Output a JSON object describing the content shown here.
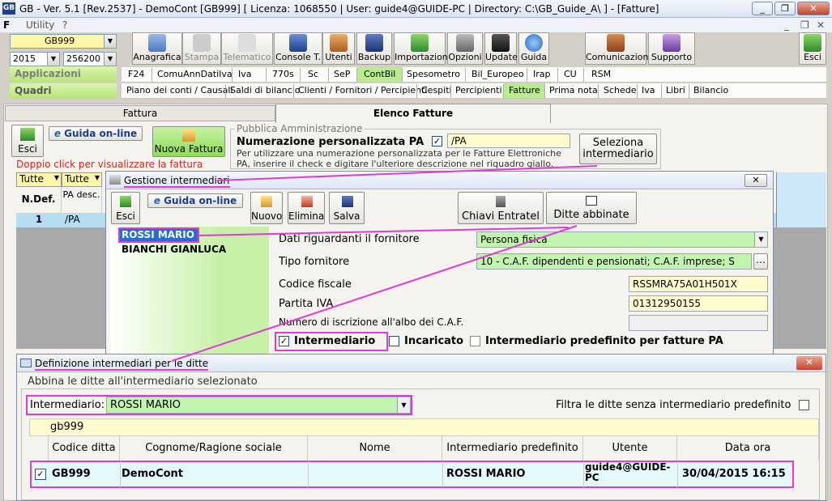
{
  "window": {
    "title": "GB - Ver. 5.1 [Rev.2537] - DemoCont [GB999]    [ Licenza: 1068550 | User: guide4@GUIDE-PC | Directory: C:\\GB_Guide_A\\ ] - [Fatture]",
    "logo": "GB",
    "menu": [
      "Utility",
      "?"
    ]
  },
  "company_combo": "GB999",
  "year_combo": "2015",
  "code_combo": "256200 -",
  "sections": {
    "applicazioni": "Applicazioni",
    "quadri": "Quadri"
  },
  "toolbar": [
    {
      "label": "Anagrafica"
    },
    {
      "label": "Stampa"
    },
    {
      "label": "Telematico"
    },
    {
      "label": "Console T."
    },
    {
      "label": "Utenti"
    },
    {
      "label": "Backup"
    },
    {
      "label": "Importazioni"
    },
    {
      "label": "Opzioni"
    },
    {
      "label": "Update"
    },
    {
      "label": "Guida"
    },
    {
      "label": "Comunicazioni"
    },
    {
      "label": "Supporto"
    },
    {
      "label": "Esci"
    }
  ],
  "app_tabs": [
    "F24",
    "ComuAnnDatiIva",
    "Iva",
    "770s",
    "Sc",
    "SeP",
    "ContBil",
    "Spesometro",
    "Bil_Europeo",
    "Irap",
    "CU",
    "RSM"
  ],
  "quadri_tabs": [
    "Piano dei conti / Causali",
    "Saldi di bilancio",
    "Clienti / Fornitori / Percipienti",
    "Cespiti",
    "Percipienti",
    "Fatture",
    "Prima nota",
    "Schede",
    "Iva",
    "Libri",
    "Bilancio"
  ],
  "doc_tabs": {
    "fattura": "Fattura",
    "elenco": "Elenco Fatture"
  },
  "main": {
    "esci": "Esci",
    "guida_online": "Guida on-line",
    "nuova_fattura": "Nuova Fattura",
    "doppio_click": "Doppio click per visualizzare la fattura",
    "pa_group": "Pubblica Amministrazione",
    "numerazione_label": "Numerazione  personalizzata PA",
    "numerazione_value": "/PA",
    "pa_note": "Per utilizzare una numerazione personalizzata per le Fatture Elettroniche PA, inserire il check e digitare l'ulteriore descrizione nel riquadro giallo.",
    "seleziona_intermediario": "Seleziona intermediario",
    "filter1": "Tutte",
    "filter2": "Tutte",
    "col_ndef": "N.Def.",
    "col_pa": "PA desc.",
    "row_num": "1",
    "row_pa": "/PA"
  },
  "gestione": {
    "title": "Gestione intermediari",
    "esci": "Esci",
    "guida_online": "Guida on-line",
    "nuovo": "Nuovo",
    "elimina": "Elimina",
    "salva": "Salva",
    "chiavi": "Chiavi Entratel",
    "ditte_abbinate": "Ditte abbinate",
    "list": [
      "ROSSI MARIO",
      "BIANCHI GIANLUCA"
    ],
    "dati_fornitore_label": "Dati riguardanti il fornitore",
    "dati_fornitore_value": "Persona fisica",
    "tipo_fornitore_label": "Tipo fornitore",
    "tipo_fornitore_value": "10 - C.A.F. dipendenti e pensionati; C.A.F. imprese; S",
    "cf_label": "Codice fiscale",
    "cf_value": "RSSMRA75A01H501X",
    "piva_label": "Partita IVA",
    "piva_value": "01312950155",
    "albo_label": "Numero di iscrizione all'albo dei C.A.F.",
    "albo_value": "",
    "chk_intermediario": "Intermediario",
    "chk_incaricato": "Incaricato",
    "chk_predefinito": "Intermediario predefinito per fatture PA"
  },
  "definizione": {
    "title": "Definizione intermediari per le ditte",
    "group": "Abbina le ditte all'intermediario selezionato",
    "intermediario_label": "Intermediario:",
    "intermediario_value": "ROSSI MARIO",
    "filtra_label": "Filtra le ditte senza intermediario predefinito",
    "search_value": "gb999",
    "columns": [
      "Codice ditta",
      "Cognome/Ragione sociale",
      "Nome",
      "Intermediario predefinito",
      "Utente",
      "Data ora"
    ],
    "row": {
      "codice": "GB999",
      "ragione": "DemoCont",
      "nome": "",
      "intermediario": "ROSSI MARIO",
      "utente": "guide4@GUIDE-PC",
      "dataora": "30/04/2015 16:15",
      "checked": true
    }
  },
  "colors": {
    "accent_magenta": "#e03ad9",
    "green": "#c2f5b0",
    "yellow": "#fffbcf",
    "selection_blue": "#1f6fd6"
  }
}
